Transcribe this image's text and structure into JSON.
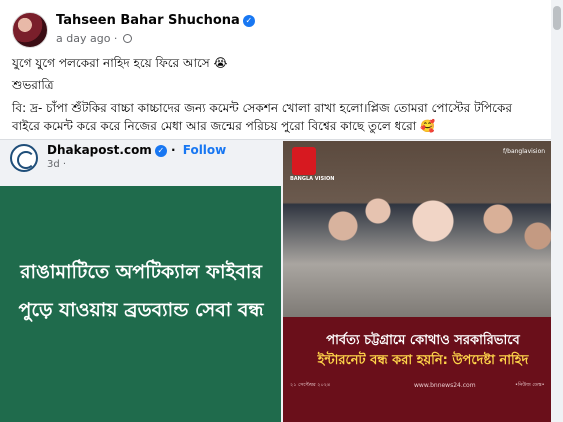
{
  "post": {
    "author": "Tahseen Bahar Shuchona",
    "time": "a day ago",
    "line1": "যুগে যুগে পলকেরা নাহিদ হয়ে ফিরে আসে 😭",
    "line2": "শুভরাত্রি",
    "line3": "বি: দ্র- চাঁপা শুঁটকির বাচ্চা কাচ্চাদের জন্য কমেন্ট সেকশন খোলা রাখা হলো।প্লিজ তোমরা পোস্টের টপিকের",
    "line4": "বাইরে কমেন্ট করে করে নিজের মেধা আর জন্মের পরিচয় পুরো বিশ্বের কাছে তুলে ধরো 🥰"
  },
  "shared": {
    "page_name": "Dhakapost.com",
    "follow_label": "Follow",
    "time": "3d",
    "left_image_text": "রাঙামাটিতে অপটিক্যাল ফাইবার পুড়ে যাওয়ায় ব্রডব্যান্ড সেবা বন্ধ",
    "right_image": {
      "brand": "BANGLA VISION",
      "handle": "f/banglavision",
      "headline_line1": "পার্বত্য চট্টগ্রামে কোথাও সরকারিভাবে",
      "headline_line2": "ইন্টারনেট বন্ধ করা হয়নি: উপদেষ্টা নাহিদ",
      "date": "২১ সেপ্টেম্বর ২০২৪",
      "site": "www.bnnews24.com",
      "footer": "•নিউজ ডেস্ক•"
    }
  },
  "colors": {
    "link_blue": "#1877f2",
    "green_card": "#1f6b4c",
    "news_bg": "#6a0f1a",
    "headline_yellow": "#ffd54a"
  },
  "icons": [
    "verified-badge-icon",
    "globe-icon",
    "scrollbar"
  ]
}
